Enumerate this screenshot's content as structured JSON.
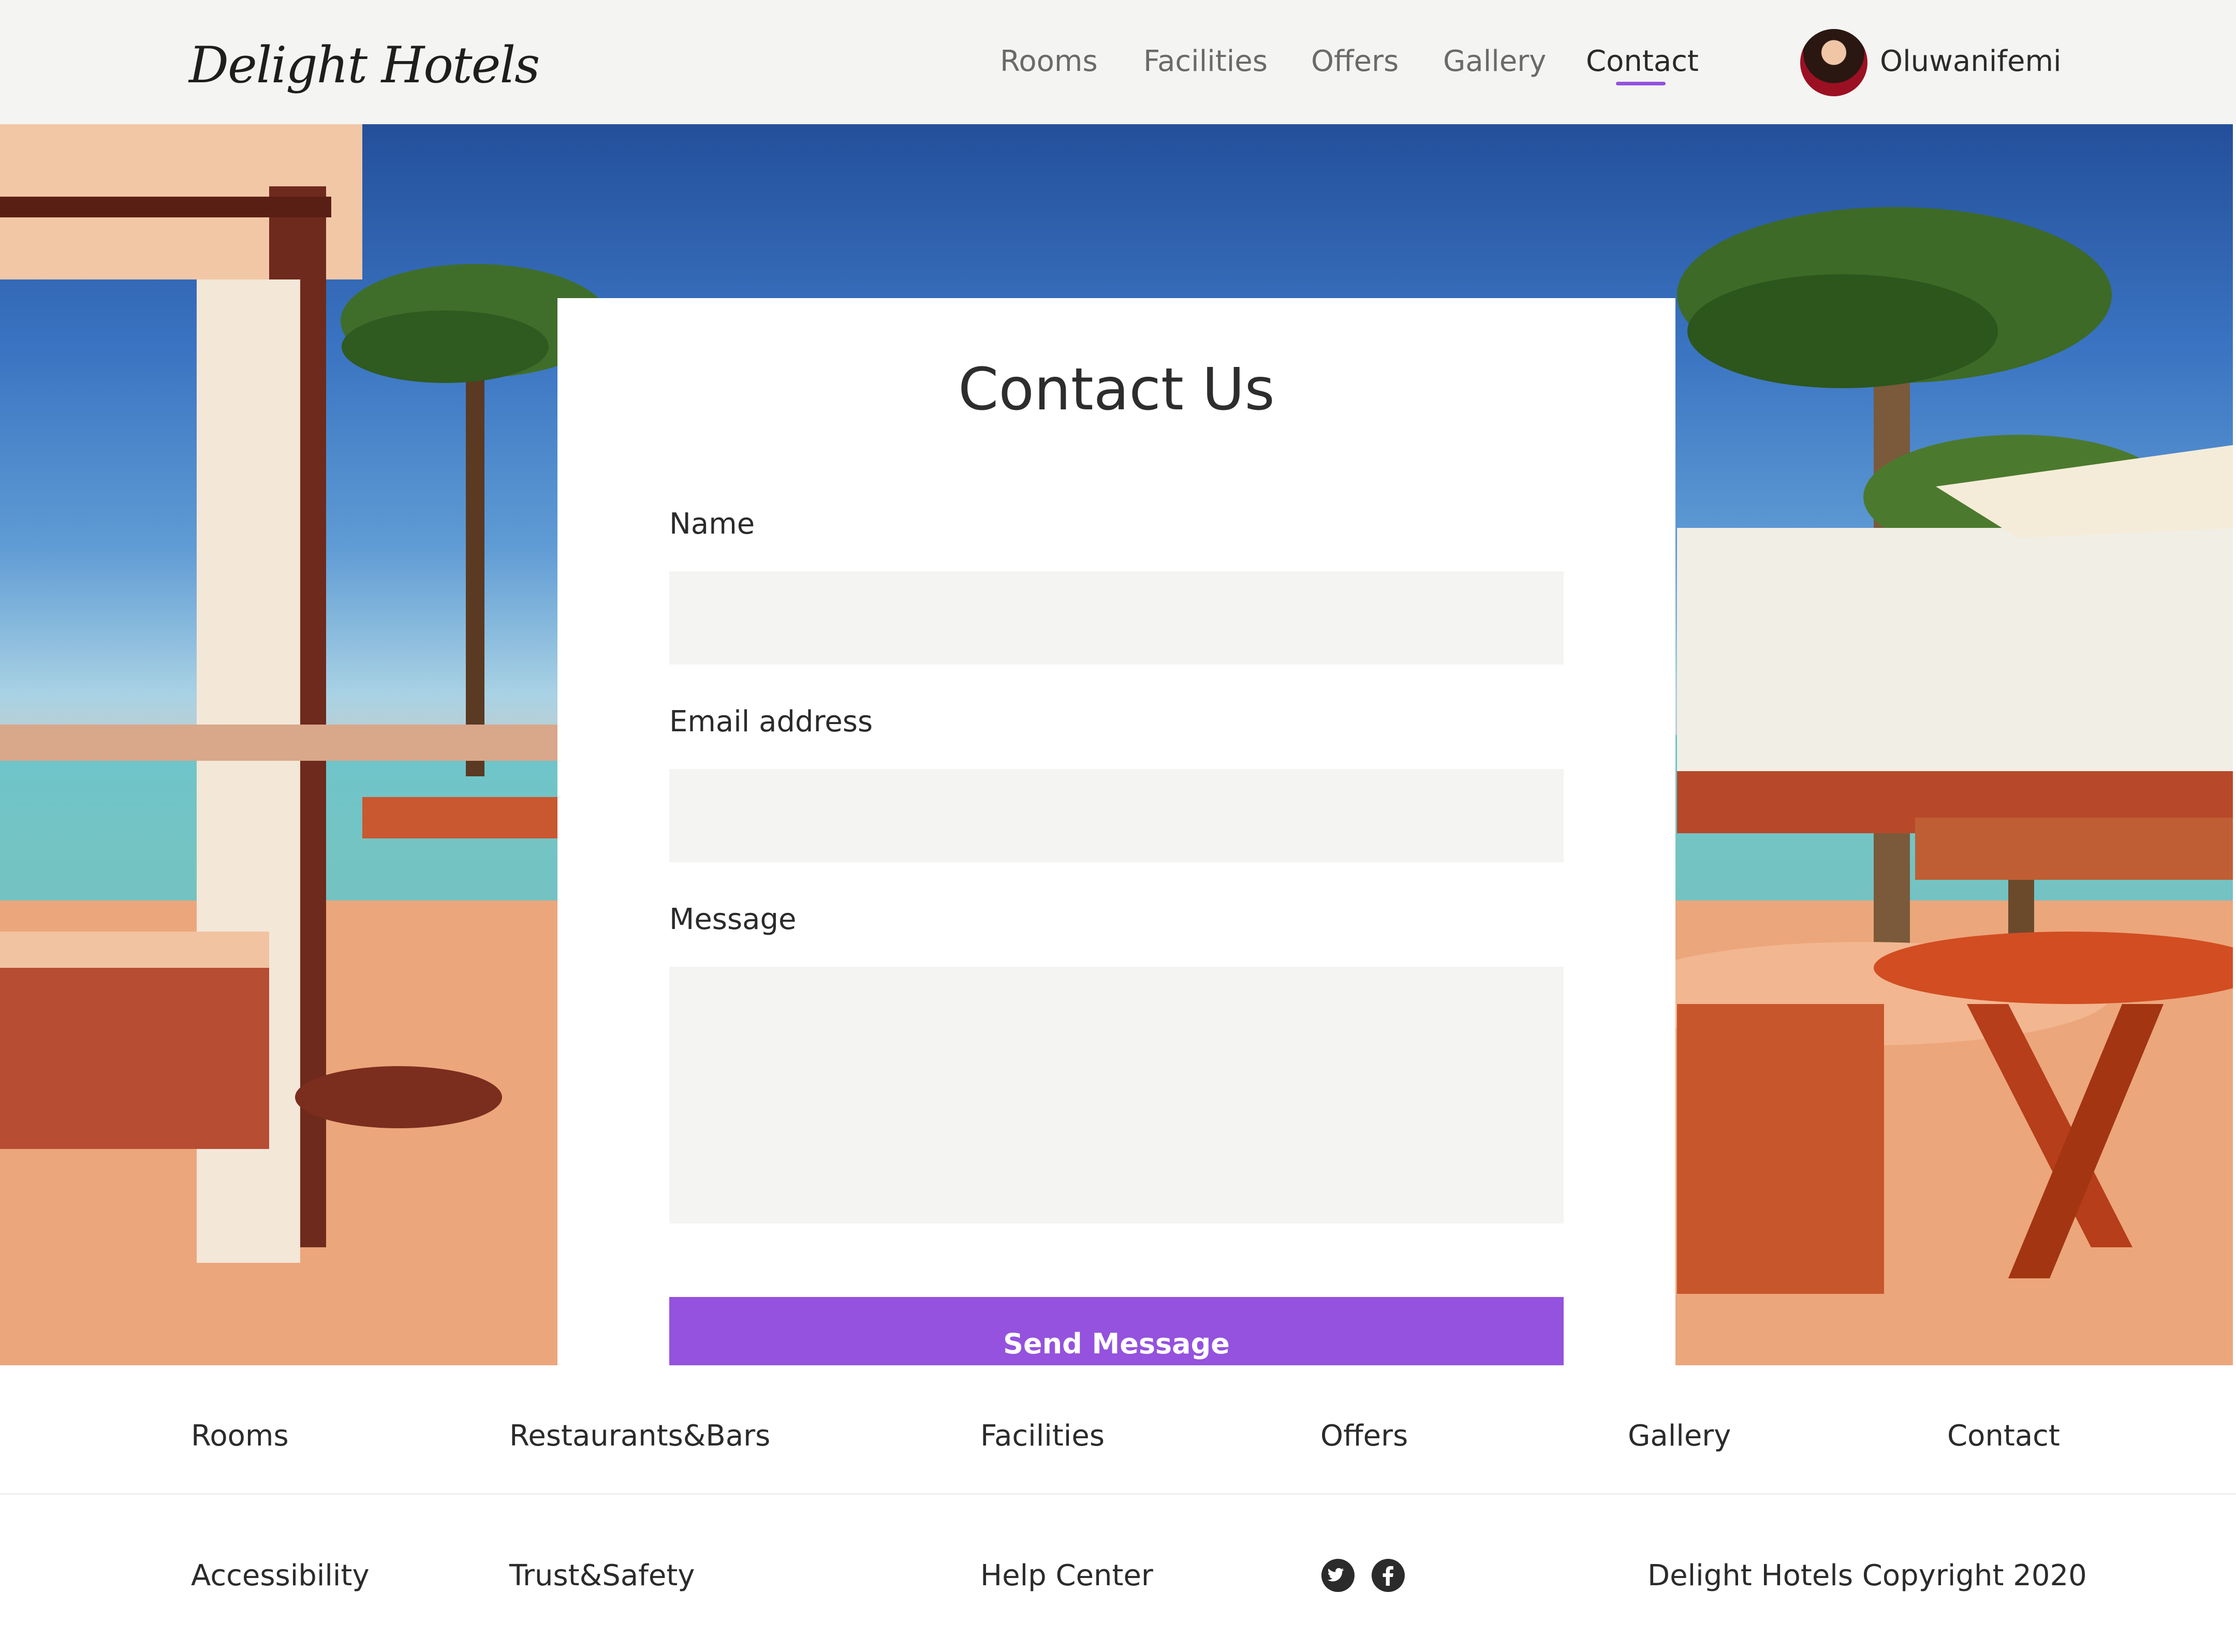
{
  "header": {
    "logo": "Delight Hotels",
    "nav": [
      "Rooms",
      "Facilities",
      "Offers",
      "Gallery",
      "Contact"
    ],
    "active_nav": "Contact",
    "user_name": "Oluwanifemi"
  },
  "contact": {
    "title": "Contact Us",
    "name_label": "Name",
    "name_value": "",
    "email_label": "Email address",
    "email_value": "",
    "message_label": "Message",
    "message_value": "",
    "send_label": "Send Message"
  },
  "footer": {
    "links": [
      "Rooms",
      "Restaurants&Bars",
      "Facilities",
      "Offers",
      "Gallery",
      "Contact"
    ],
    "bottom_links": [
      "Accessibility",
      "Trust&Safety",
      "Help Center"
    ],
    "social_icons": [
      "twitter-icon",
      "facebook-icon"
    ],
    "copyright": "Delight Hotels Copyright 2020"
  },
  "colors": {
    "accent": "#9452de",
    "header_bg": "#f4f4f2",
    "input_bg": "#f4f4f2",
    "text": "#2b2b2b"
  }
}
